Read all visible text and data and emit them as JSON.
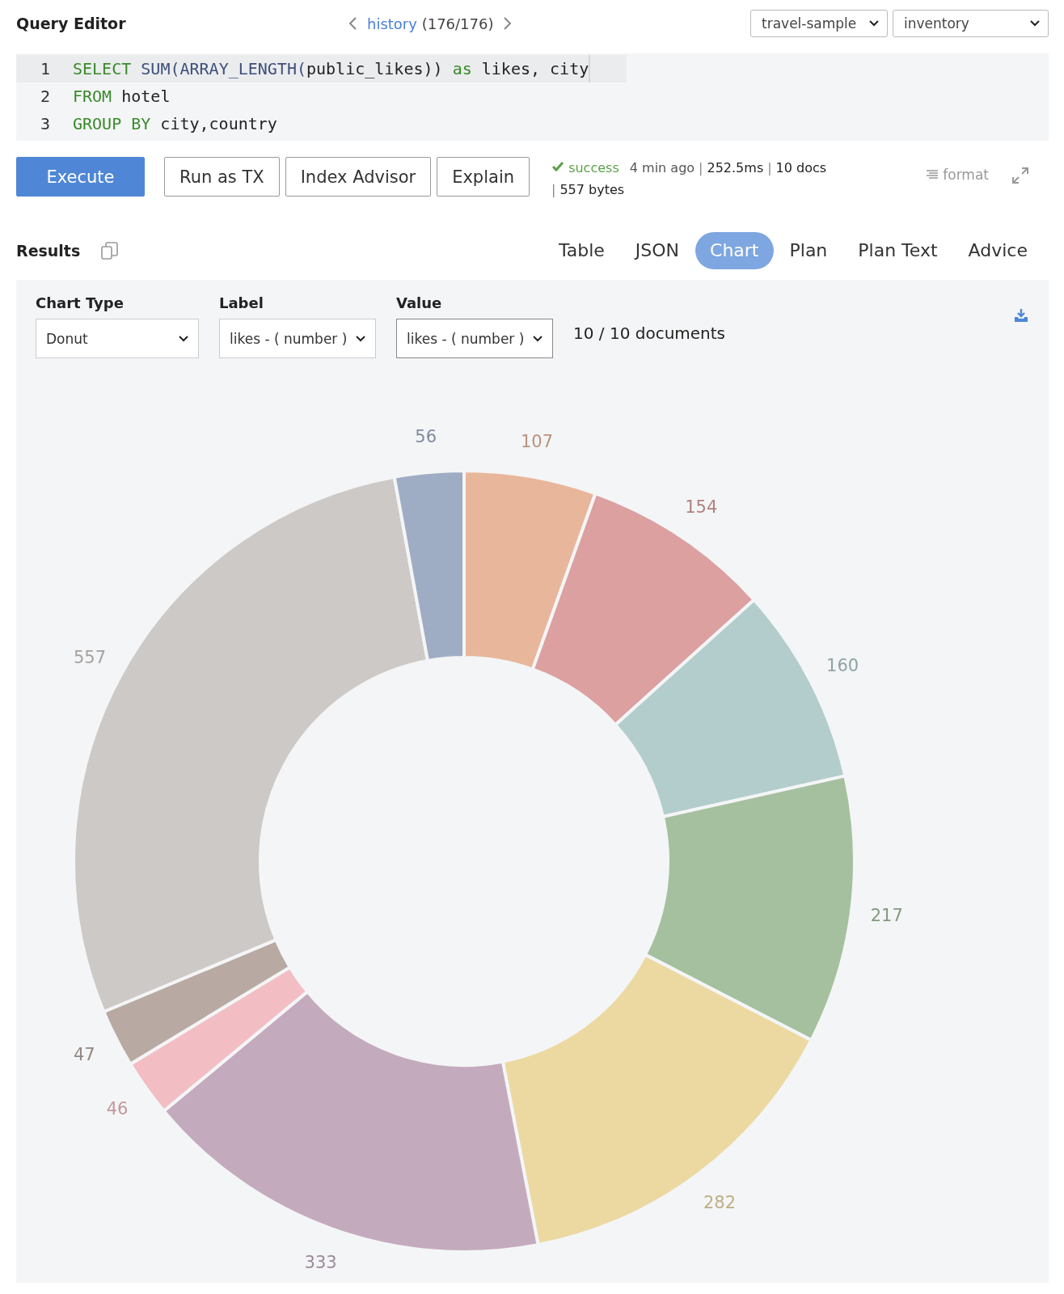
{
  "header": {
    "title": "Query Editor",
    "history_link": "history",
    "history_count": "(176/176)",
    "bucket": "travel-sample",
    "scope": "inventory"
  },
  "editor": {
    "lines": [
      {
        "number": "1",
        "current": true,
        "tokens": [
          {
            "kind": "keyword",
            "text": "SELECT "
          },
          {
            "kind": "function",
            "text": "SUM(ARRAY_LENGTH("
          },
          {
            "kind": "plain",
            "text": "public_likes)) "
          },
          {
            "kind": "keyword",
            "text": "as"
          },
          {
            "kind": "plain",
            "text": " likes, city"
          }
        ]
      },
      {
        "number": "2",
        "current": false,
        "tokens": [
          {
            "kind": "keyword",
            "text": "FROM"
          },
          {
            "kind": "plain",
            "text": " hotel"
          }
        ]
      },
      {
        "number": "3",
        "current": false,
        "tokens": [
          {
            "kind": "keyword",
            "text": "GROUP BY"
          },
          {
            "kind": "plain",
            "text": " city,country"
          }
        ]
      }
    ]
  },
  "actions": {
    "buttons": [
      {
        "label": "Execute",
        "kind": "primary"
      },
      {
        "label": "Run as TX",
        "kind": "secondary"
      },
      {
        "label": "Index Advisor",
        "kind": "secondary"
      },
      {
        "label": "Explain",
        "kind": "secondary"
      }
    ],
    "status": {
      "result": "success",
      "elapsed": "4 min ago",
      "time": "252.5ms",
      "docs": "10 docs",
      "size": "557 bytes",
      "separator": "|"
    },
    "format": "format"
  },
  "results": {
    "title": "Results",
    "tabs": [
      {
        "label": "Table",
        "selected": false
      },
      {
        "label": "JSON",
        "selected": false
      },
      {
        "label": "Chart",
        "selected": true
      },
      {
        "label": "Plan",
        "selected": false
      },
      {
        "label": "Plan Text",
        "selected": false
      },
      {
        "label": "Advice",
        "selected": false
      }
    ],
    "controls": [
      {
        "label": "Chart Type",
        "value": "Donut",
        "focused": false
      },
      {
        "label": "Label",
        "value": "likes - ( number )",
        "focused": false
      },
      {
        "label": "Value",
        "value": "likes - ( number )",
        "focused": true
      }
    ],
    "count": "10 / 10 documents",
    "chart_data": {
      "type": "donut",
      "categories": [
        "107",
        "154",
        "160",
        "217",
        "282",
        "333",
        "46",
        "47",
        "557",
        "56"
      ],
      "values": [
        107,
        154,
        160,
        217,
        282,
        333,
        46,
        47,
        557,
        56
      ],
      "colors": [
        "#e8b79b",
        "#dca0a0",
        "#b2cdcc",
        "#a5c09e",
        "#ecd9a2",
        "#c3abbd",
        "#f2bec4",
        "#b8aaa2",
        "#cdc9c6",
        "#9fadc4"
      ],
      "data_labels": true
    }
  }
}
